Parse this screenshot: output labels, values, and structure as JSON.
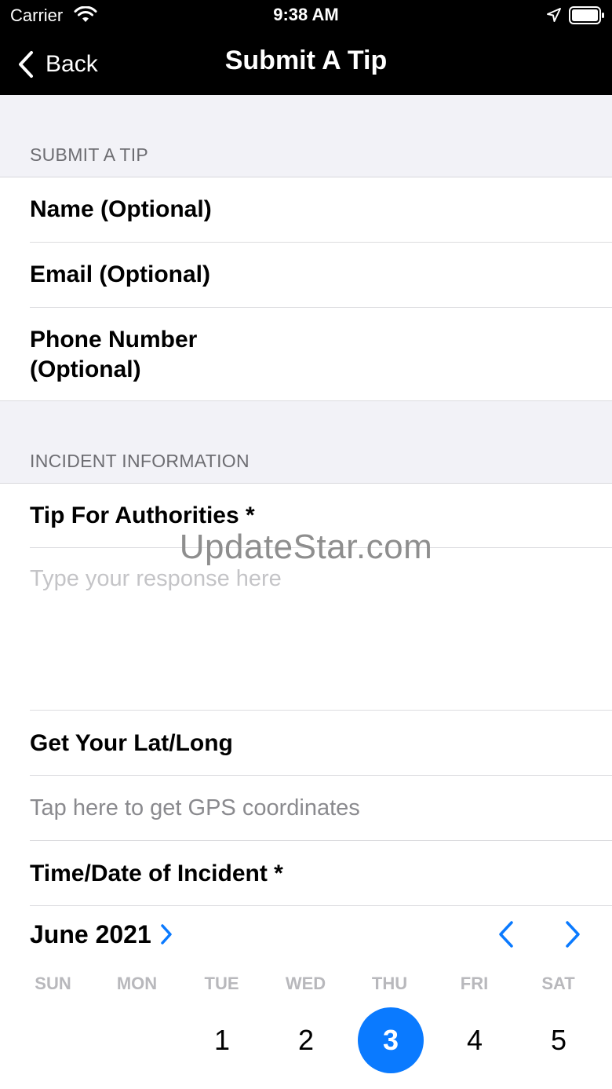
{
  "status_bar": {
    "carrier": "Carrier",
    "time": "9:38 AM"
  },
  "nav": {
    "back_label": "Back",
    "title": "Submit A Tip"
  },
  "sections": {
    "contact_header": "SUBMIT A TIP",
    "incident_header": "INCIDENT INFORMATION"
  },
  "fields": {
    "name": "Name (Optional)",
    "email": "Email (Optional)",
    "phone_line1": "Phone Number",
    "phone_line2": "(Optional)",
    "tip": "Tip For Authorities *",
    "tip_placeholder": "Type your response here",
    "latlong": "Get Your Lat/Long",
    "gps_hint": "Tap here to get GPS coordinates",
    "datetime": "Time/Date of Incident *"
  },
  "watermark": "UpdateStar.com",
  "calendar": {
    "month": "June 2021",
    "weekdays": [
      "SUN",
      "MON",
      "TUE",
      "WED",
      "THU",
      "FRI",
      "SAT"
    ],
    "days": [
      "1",
      "2",
      "3",
      "4",
      "5"
    ],
    "selected_day": "3"
  },
  "colors": {
    "accent": "#0a7aff",
    "bar": "#000000",
    "group_bg": "#f2f2f7"
  }
}
